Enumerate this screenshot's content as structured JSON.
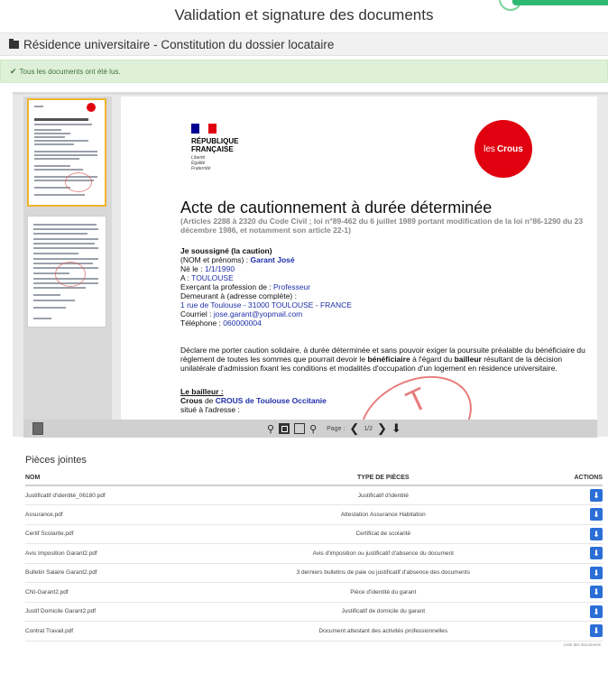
{
  "header": {
    "title": "Validation et signature des documents"
  },
  "panel": {
    "title": "Résidence universitaire - Constitution du dossier locataire",
    "icon": "folder-icon"
  },
  "alert": {
    "text": "Tous les documents ont été lus.",
    "icon": "check-icon"
  },
  "document": {
    "republique": [
      "RÉPUBLIQUE",
      "FRANÇAISE"
    ],
    "devise": [
      "Liberté",
      "Égalité",
      "Fraternité"
    ],
    "crous_logo": {
      "prefix": "les",
      "name": "Crous"
    },
    "title": "Acte de cautionnement à durée déterminée",
    "subtitle": "(Articles 2288 à 2320 du Code Civil ; loi n°89-462 du 6 juillet 1989 portant modification de la loi n°86-1290 du 23 décembre 1986, et notamment son article 22-1)",
    "soussigne": "Je soussigné (la caution)",
    "nom_label": "(NOM et prénoms) :",
    "nom_value": "Garant José",
    "ne_le_label": "Né le :",
    "ne_le_value": "1/1/1990",
    "a_label": "A :",
    "a_value": "TOULOUSE",
    "profession_label": "Exerçant la profession de :",
    "profession_value": "Professeur",
    "demeurant_label": "Demeurant à (adresse complète) :",
    "adresse_value": "1 rue de Toulouse - 31000 TOULOUSE - FRANCE",
    "courriel_label": "Courriel :",
    "courriel_value": "jose.garant@yopmail.com",
    "telephone_label": "Téléphone :",
    "telephone_value": "060000004",
    "para_1": "Déclare me porter caution solidaire, à durée déterminée et sans pouvoir exiger la poursuite préalable du bénéficiaire du règlement de toutes les sommes que pourrait devoir le",
    "para_b1": "bénéficiaire",
    "para_2": "à l'égard du",
    "para_b2": "bailleur",
    "para_3": "résultant de la décision unilatérale d'admission fixant les conditions et modalités d'occupation d'un logement en résidence universitaire.",
    "bailleur_label": "Le bailleur :",
    "crous_label": "Crous",
    "de_label": "de",
    "crous_value": "CROUS de Toulouse Occitanie",
    "situe": "situé à l'adresse :",
    "stamp_letter": "T"
  },
  "toolbar": {
    "page_label": "Page :",
    "page_value": "1/2"
  },
  "attachments": {
    "title": "Pièces jointes",
    "columns": [
      "NOM",
      "TYPE DE PIÈCES",
      "ACTIONS"
    ],
    "rows": [
      {
        "name": "Justificatif d'identité_06180.pdf",
        "type": "Justificatif d'identité"
      },
      {
        "name": "Assurance.pdf",
        "type": "Attestation Assurance Habitation"
      },
      {
        "name": "Certif Scolarite.pdf",
        "type": "Certificat de scolarité"
      },
      {
        "name": "Avis Imposition Garant2.pdf",
        "type": "Avis d'imposition ou justificatif d'absence du document"
      },
      {
        "name": "Bulletin Salaire Garant2.pdf",
        "type": "3 derniers bulletins de paie ou justificatif d'absence des documents"
      },
      {
        "name": "CNI-Garant2.pdf",
        "type": "Pièce d'identité du garant"
      },
      {
        "name": "Justif Domicile Garant2.pdf",
        "type": "Justificatif de domicile du garant"
      },
      {
        "name": "Contrat Travail.pdf",
        "type": "Document attestant des activités professionnelles"
      }
    ],
    "action_icon": "download-icon",
    "footnote": "Liste des documents"
  },
  "colors": {
    "alert_bg": "#dff0d8",
    "alert_text": "#3c763d",
    "crous_red": "#e1000f",
    "action_blue": "#2b6fd6",
    "thumb_active_border": "#f0b429"
  }
}
